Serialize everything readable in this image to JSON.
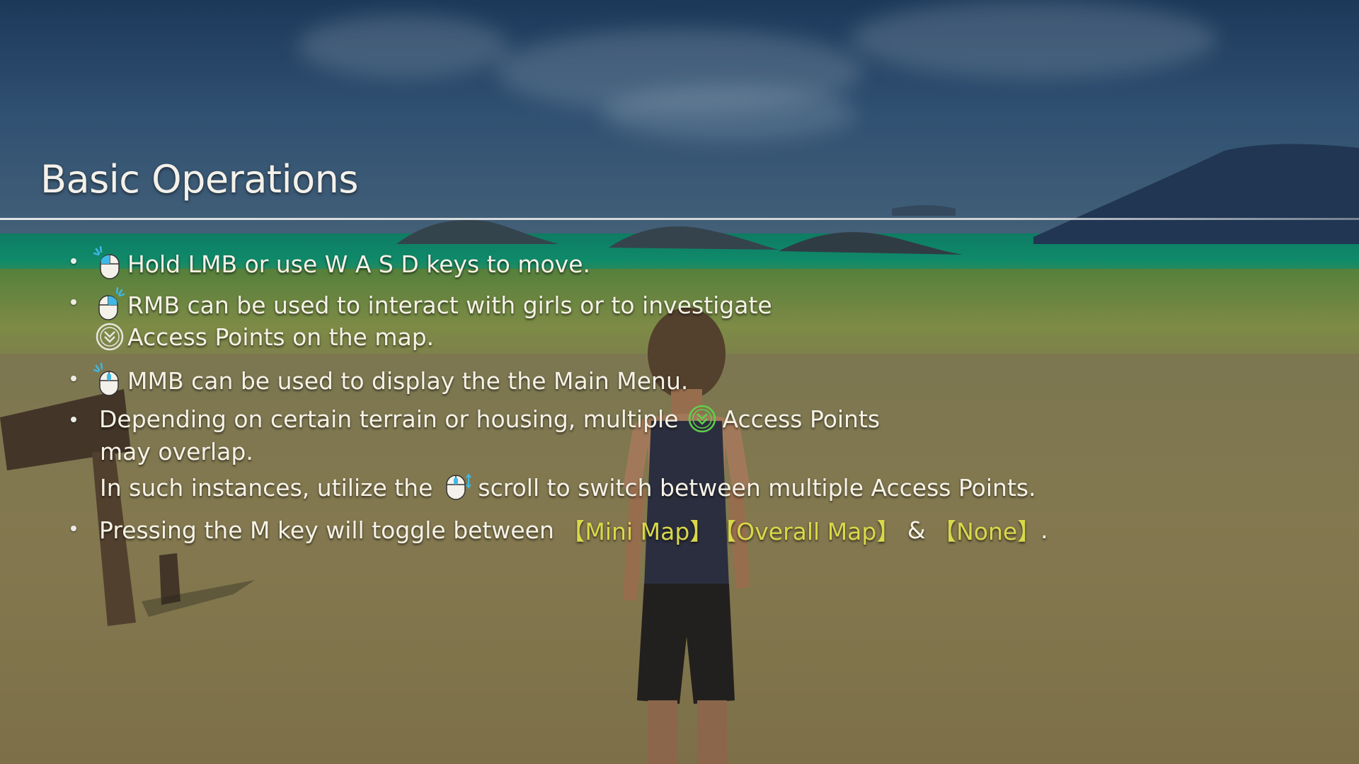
{
  "panel": {
    "title": "Basic Operations"
  },
  "instructions": {
    "item1_text": "Hold LMB or use W A S D keys to move.",
    "item2_line1": "RMB can be used to interact with girls or to investigate",
    "item2_line2": "Access Points on the map.",
    "item3_text": "MMB can be used to display the the Main Menu.",
    "item4_line1_a": "Depending on certain terrain or housing, multiple",
    "item4_line1_b": "Access Points",
    "item4_line2": "may overlap.",
    "item4_line3_a": "In such instances, utilize the",
    "item4_line3_b": "scroll to switch between multiple Access Points.",
    "item5_a": "Pressing the M key will toggle between ",
    "item5_mini": "【Mini Map】",
    "item5_overall": "【Overall Map】",
    "item5_amp": " & ",
    "item5_none": "【None】",
    "item5_end": "."
  },
  "icons": {
    "lmb": "mouse-left-click-icon",
    "rmb": "mouse-right-click-icon",
    "mmb": "mouse-middle-click-icon",
    "scroll": "mouse-scroll-icon",
    "access_point_gray": "access-point-icon",
    "access_point_green": "access-point-icon"
  },
  "colors": {
    "text": "#f6f2e6",
    "highlight": "#d9d84a",
    "mouse_accent": "#3fb8e6",
    "access_point_green": "#5fd14a"
  }
}
